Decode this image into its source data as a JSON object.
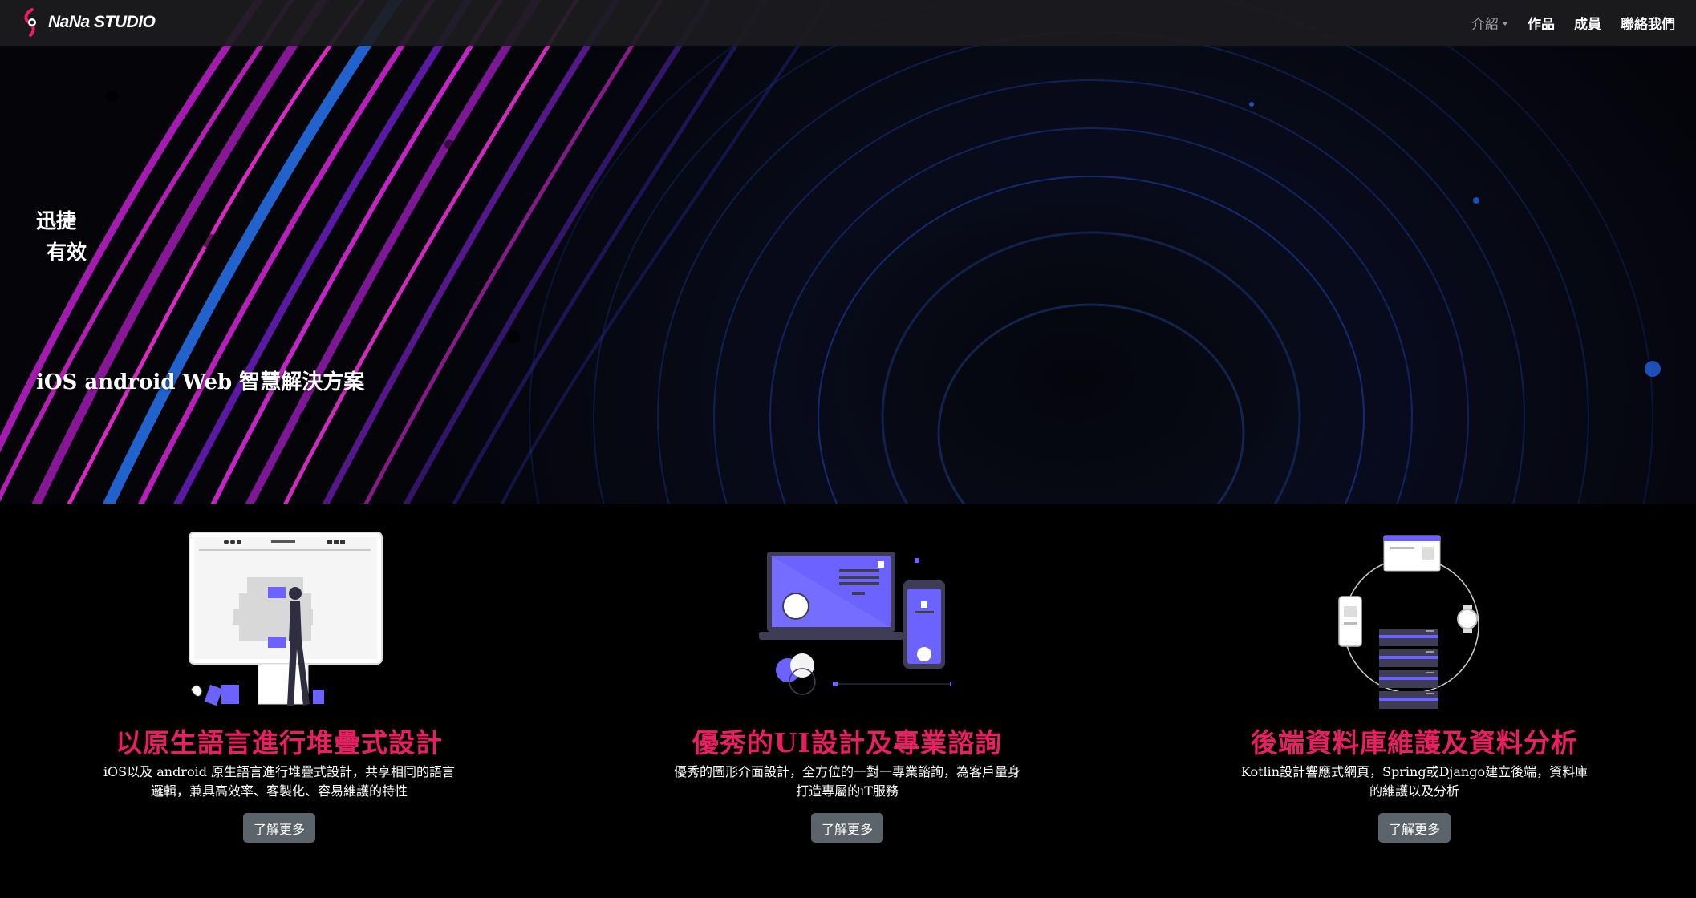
{
  "nav": {
    "brand": "NaNa STUDIO",
    "links": [
      {
        "label": "介紹",
        "dropdown": true
      },
      {
        "label": "作品"
      },
      {
        "label": "成員"
      },
      {
        "label": "聯絡我們"
      }
    ]
  },
  "hero": {
    "line1": "迅捷",
    "line2": "有效",
    "tagline": "iOS android Web 智慧解決方案"
  },
  "features": [
    {
      "title": "以原生語言進行堆疊式設計",
      "desc": "iOS以及 android 原生語言進行堆疊式設計，共享相同的語言邏輯，兼具高效率、客製化、容易維護的特性",
      "button": "了解更多"
    },
    {
      "title": "優秀的UI設計及專業諮詢",
      "desc": "優秀的圖形介面設計，全方位的一對一專業諮詢，為客戶量身打造專屬的iT服務",
      "button": "了解更多"
    },
    {
      "title": "後端資料庫維護及資料分析",
      "desc": "Kotlin設計響應式網頁，Spring或Django建立後端，資料庫的維護以及分析",
      "button": "了解更多"
    }
  ],
  "colors": {
    "accent": "#e91e63",
    "illustration": "#6c63ff",
    "button": "#5c646b",
    "navbar": "#1c1c20"
  }
}
